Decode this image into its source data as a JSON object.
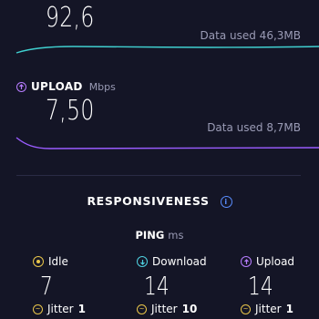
{
  "download": {
    "value": "92,6",
    "data_used": "Data used 46,3MB"
  },
  "upload": {
    "label": "UPLOAD",
    "unit": "Mbps",
    "value": "7,50",
    "data_used": "Data used 8,7MB"
  },
  "responsiveness": {
    "title": "RESPONSIVENESS",
    "ping_label": "PING",
    "ping_unit": "ms",
    "columns": [
      {
        "label": "Idle",
        "value": "7",
        "jitter_label": "Jitter",
        "jitter_value": "1"
      },
      {
        "label": "Download",
        "value": "14",
        "jitter_label": "Jitter",
        "jitter_value": "10"
      },
      {
        "label": "Upload",
        "value": "14",
        "jitter_label": "Jitter",
        "jitter_value": "1"
      }
    ]
  },
  "colors": {
    "background": "#141526",
    "download_wave": "#40d0d0",
    "upload_wave": "#9a5cff",
    "idle_icon": "#e8c54a",
    "download_icon": "#4fd1e0",
    "upload_icon": "#b77dff",
    "info_icon": "#5a8dff"
  },
  "icons": {
    "upload_header": "upload-arrow-icon",
    "info": "info-icon",
    "idle": "idle-icon",
    "download": "download-arrow-icon",
    "upload": "upload-arrow-icon",
    "jitter": "jitter-icon"
  }
}
